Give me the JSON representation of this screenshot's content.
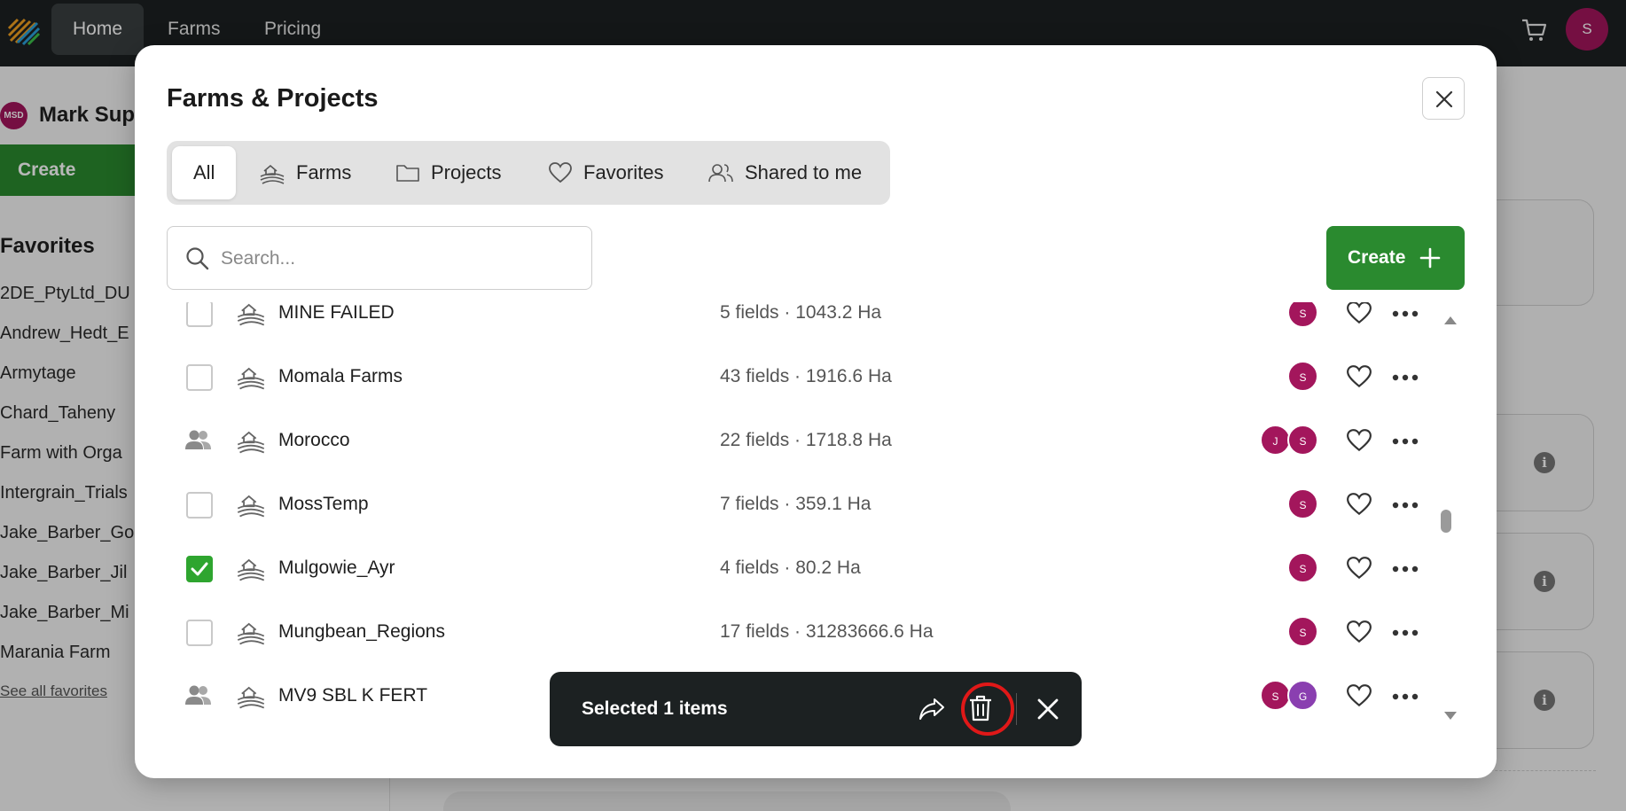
{
  "topnav": {
    "items": [
      "Home",
      "Farms",
      "Pricing"
    ],
    "active": "Home",
    "avatar_initial": "S"
  },
  "background": {
    "user_initials": "MSD",
    "user_name": "Mark Sup",
    "create_label": "Create",
    "favorites_title": "Favorites",
    "favorites": [
      "2DE_PtyLtd_DU",
      "Andrew_Hedt_E",
      "Armytage",
      "Chard_Taheny",
      "Farm with Orga",
      "Intergrain_Trials",
      "Jake_Barber_Go",
      "Jake_Barber_Jil",
      "Jake_Barber_Mi",
      "Marania Farm"
    ],
    "see_all": "See all favorites",
    "info_glyph": "i"
  },
  "modal": {
    "title": "Farms & Projects",
    "tabs": [
      "All",
      "Farms",
      "Projects",
      "Favorites",
      "Shared to me"
    ],
    "search_placeholder": "Search...",
    "create_label": "Create",
    "rows": [
      {
        "name": "MINE FAILED",
        "meta": "5 fields · 1043.2 Ha",
        "avatars": [
          "S"
        ],
        "shared": false,
        "checked": false
      },
      {
        "name": "Momala Farms",
        "meta": "43 fields · 1916.6 Ha",
        "avatars": [
          "S"
        ],
        "shared": false,
        "checked": false
      },
      {
        "name": "Morocco",
        "meta": "22 fields · 1718.8 Ha",
        "avatars": [
          "J",
          "S"
        ],
        "shared": true,
        "checked": false
      },
      {
        "name": "MossTemp",
        "meta": "7 fields · 359.1 Ha",
        "avatars": [
          "S"
        ],
        "shared": false,
        "checked": false
      },
      {
        "name": "Mulgowie_Ayr",
        "meta": "4 fields · 80.2 Ha",
        "avatars": [
          "S"
        ],
        "shared": false,
        "checked": true
      },
      {
        "name": "Mungbean_Regions",
        "meta": "17 fields · 31283666.6 Ha",
        "avatars": [
          "S"
        ],
        "shared": false,
        "checked": false
      },
      {
        "name": "MV9 SBL K FERT",
        "meta": "",
        "avatars": [
          "S",
          "G"
        ],
        "shared": true,
        "checked": false
      }
    ],
    "selection": {
      "text": "Selected 1 items"
    }
  },
  "colors": {
    "brand_green": "#2a8a2f",
    "check_green": "#2ea52f",
    "avatar_magenta": "#a3165c",
    "avatar_purple": "#8a3fb0",
    "nav_dark": "#1c2122",
    "highlight_red": "#e01818"
  }
}
